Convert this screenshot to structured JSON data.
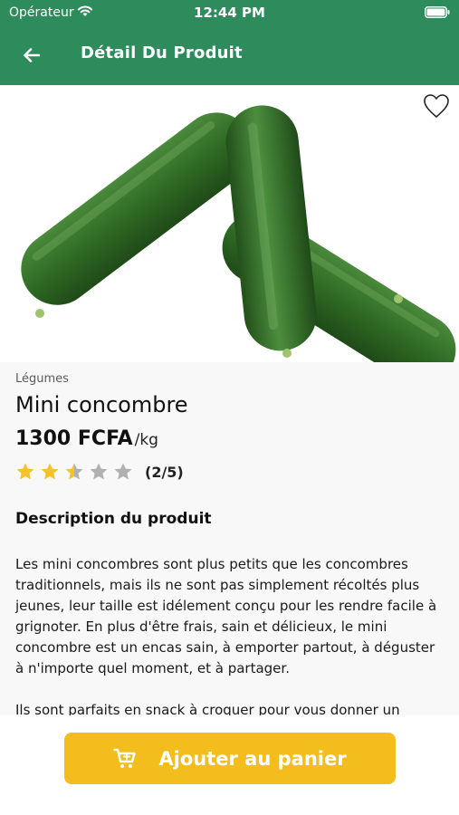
{
  "status_bar": {
    "carrier": "Opérateur",
    "time": "12:44 PM"
  },
  "header": {
    "title": "Détail Du Produit",
    "back_icon": "arrow-left-icon"
  },
  "product": {
    "image": "cucumbers-image",
    "favorite_icon": "heart-outline-icon",
    "category": "Légumes",
    "name": "Mini concombre",
    "price": "1300 FCFA",
    "unit": "/kg",
    "rating": 2.5,
    "rating_max": 5,
    "rating_label": "(2/5)",
    "description_title": "Description du produit",
    "description_p1": "Les mini concombres sont plus petits que les concombres traditionnels, mais ils ne sont pas simplement récoltés plus jeunes, leur taille est idélement conçu pour les rendre facile à grignoter. En plus d'être frais, sain et délicieux, le mini concombre est un encas sain, à emporter partout, à déguster à n'importe quel moment, et à partager.",
    "description_p2": "Ils sont parfaits en snack à croquer pour vous donner un"
  },
  "cart_button": {
    "label": "Ajouter au panier",
    "icon": "cart-icon"
  },
  "colors": {
    "header": "#2e8b5c",
    "button": "#f2bd1d",
    "star_filled": "#f5c22a",
    "star_empty": "#b0b0b0"
  }
}
